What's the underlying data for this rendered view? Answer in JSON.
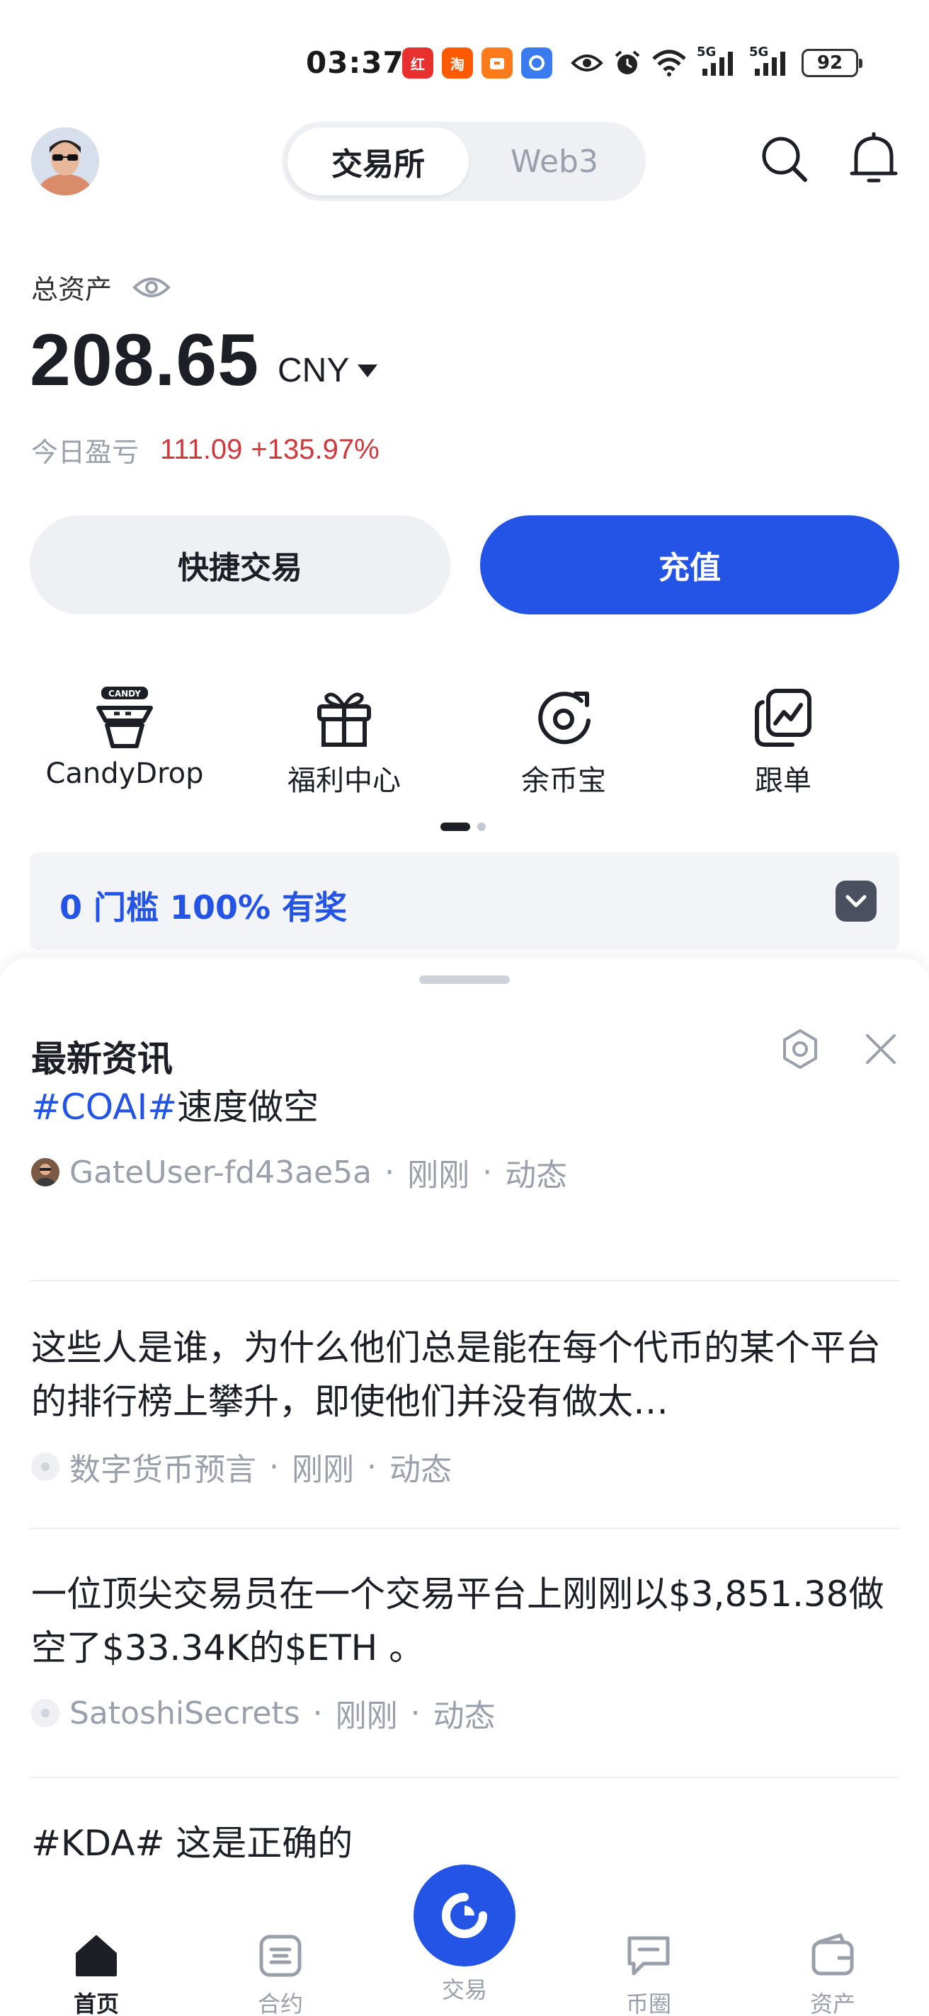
{
  "status_bar": {
    "time": "03:37",
    "network_1": "5G",
    "network_2": "5G",
    "battery": "92",
    "app_icons": [
      "jingdong-app-icon",
      "taobao-app-icon",
      "package-app-icon",
      "browser-app-icon"
    ],
    "app_icon_text": [
      "红",
      "淘"
    ]
  },
  "header": {
    "tabs": [
      "交易所",
      "Web3"
    ],
    "active_tab": "交易所"
  },
  "assets": {
    "label": "总资产",
    "total": "208.65",
    "currency": "CNY",
    "pnl_label": "今日盈亏",
    "pnl_value": "111.09",
    "pnl_percent": "+135.97%"
  },
  "actions": {
    "quick_trade": "快捷交易",
    "deposit": "充值"
  },
  "shortcuts": [
    {
      "label": "CandyDrop",
      "icon": "candy-icon",
      "badge": "CANDY"
    },
    {
      "label": "福利中心",
      "icon": "gift-icon"
    },
    {
      "label": "余币宝",
      "icon": "savings-icon"
    },
    {
      "label": "跟单",
      "icon": "copy-trade-icon"
    }
  ],
  "promo": {
    "text": "0 门槛 100% 有奖"
  },
  "news": {
    "title": "最新资讯",
    "items": [
      {
        "tag": "#COAI#",
        "headline": "速度做空",
        "author": "GateUser-fd43ae5a",
        "time": "刚刚",
        "type": "动态"
      },
      {
        "tag": "",
        "headline": "这些人是谁，为什么他们总是能在每个代币的某个平台的排行榜上攀升，即使他们并没有做太…",
        "author": "数字货币预言",
        "time": "刚刚",
        "type": "动态"
      },
      {
        "tag": "",
        "headline": "一位顶尖交易员在一个交易平台上刚刚以$3,851.38做空了$33.34K的$ETH 。",
        "author": "SatoshiSecrets",
        "time": "刚刚",
        "type": "动态"
      },
      {
        "tag": "",
        "headline": "#KDA# 这是正确的"
      }
    ]
  },
  "bottom_nav": {
    "items": [
      "首页",
      "合约",
      "交易",
      "币圈",
      "资产"
    ],
    "active": "首页"
  },
  "colors": {
    "accent": "#2354e6",
    "loss_gain_red": "#d2373b",
    "muted": "#9aa0ab"
  }
}
